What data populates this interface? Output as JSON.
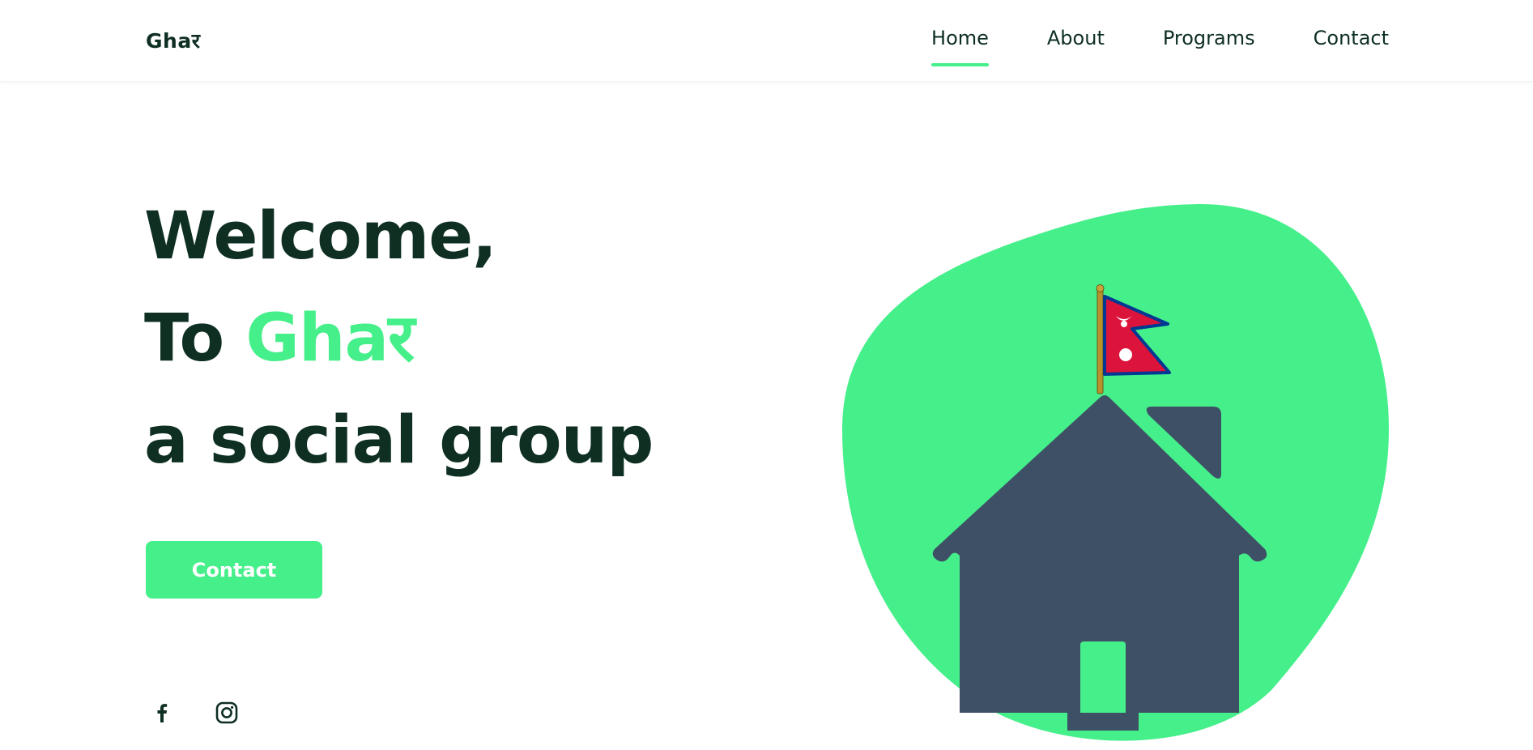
{
  "header": {
    "logo": "Ghaर",
    "nav": [
      {
        "label": "Home",
        "active": true
      },
      {
        "label": "About",
        "active": false
      },
      {
        "label": "Programs",
        "active": false
      },
      {
        "label": "Contact",
        "active": false
      }
    ]
  },
  "hero": {
    "line1": "Welcome,",
    "line2_prefix": "To",
    "line2_accent": "Ghaर",
    "line3": "a social group",
    "cta_label": "Contact"
  },
  "social": {
    "icons": [
      "facebook-icon",
      "instagram-icon"
    ]
  },
  "illustration": {
    "icons": [
      "house-icon",
      "nepal-flag-icon"
    ]
  },
  "colors": {
    "accent": "#45ef8a",
    "text_dark": "#0e2f22",
    "house": "#3e5066",
    "flag_red": "#dc143c",
    "flag_blue": "#003893"
  }
}
